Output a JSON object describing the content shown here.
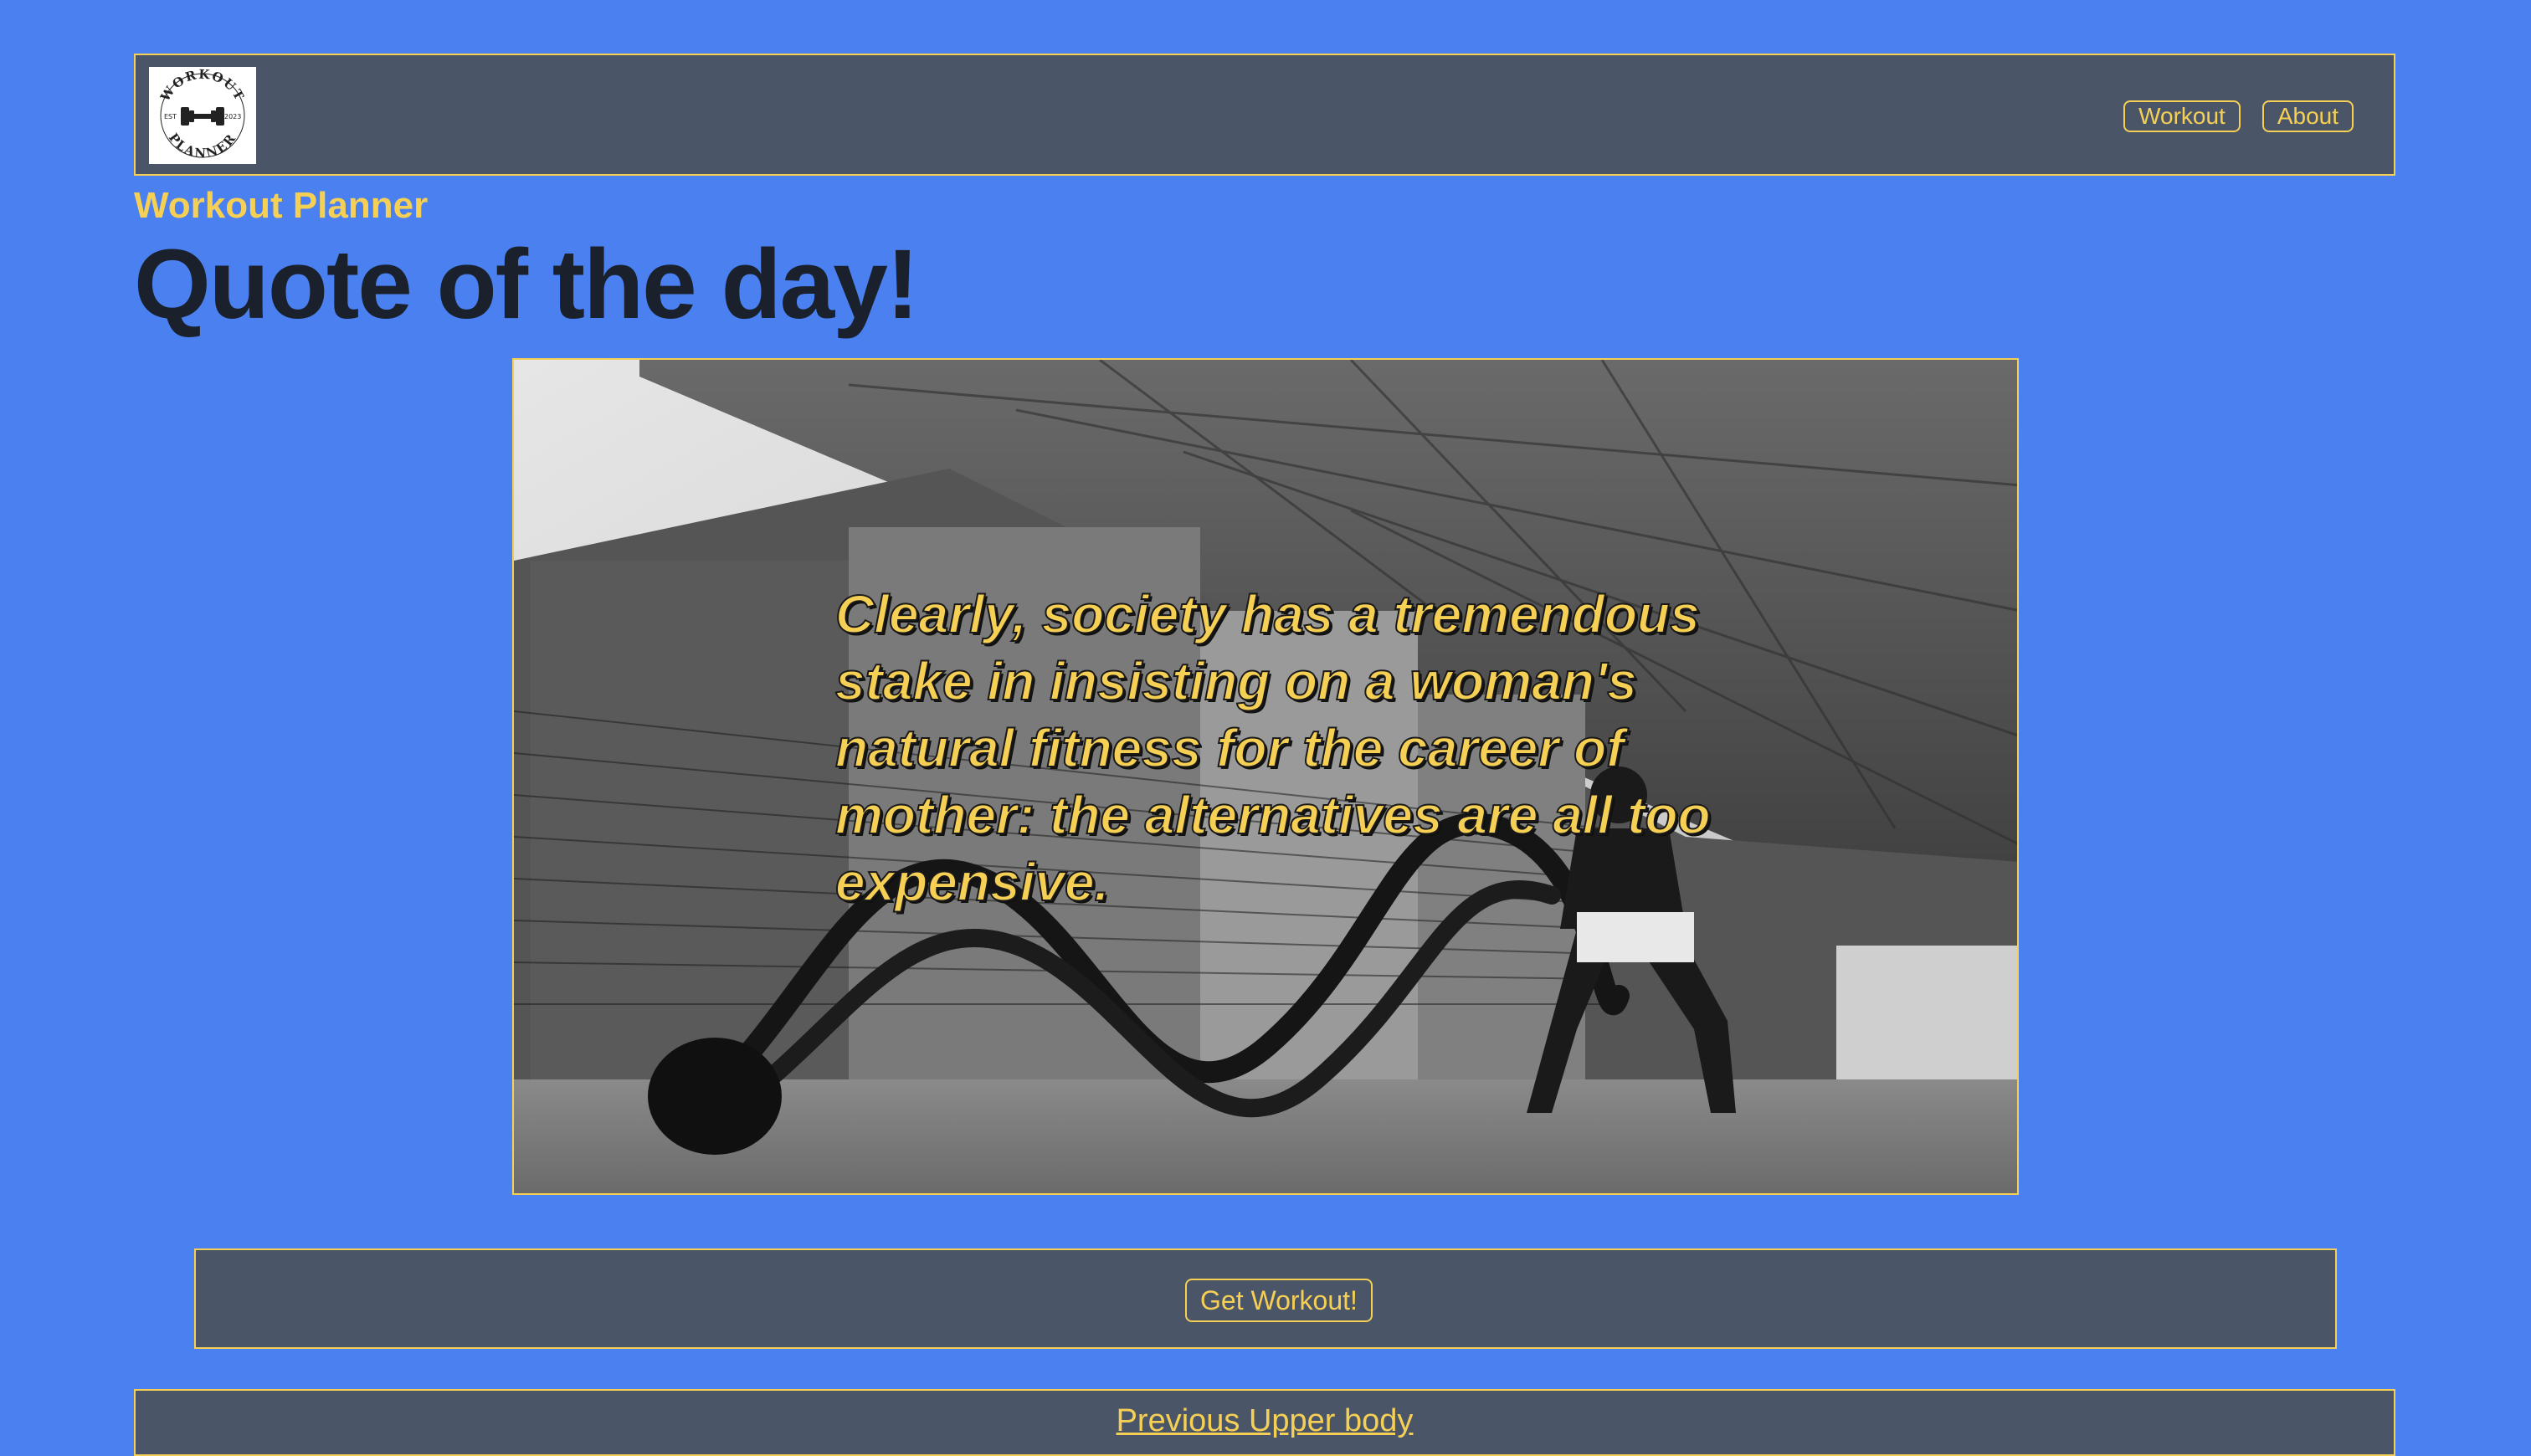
{
  "navbar": {
    "logo": {
      "icon": "workout-planner-logo",
      "text_top": "WORKOUT",
      "text_bottom": "PLANNER",
      "text_left": "EST",
      "text_right": "2023"
    },
    "links": [
      {
        "label": "Workout"
      },
      {
        "label": "About"
      }
    ]
  },
  "brand": "Workout Planner",
  "page_title": "Quote of the day!",
  "hero": {
    "image": "black-and-white photo of athlete training with battle ropes under a concrete overpass",
    "quote": "Clearly, society has a tremendous stake in insisting on a woman's natural fitness for the career of mother: the alternatives are all too expensive."
  },
  "actions": {
    "get_workout_label": "Get Workout!"
  },
  "history": {
    "previous_label": "Previous Upper body"
  },
  "colors": {
    "background": "#4a80ef",
    "panel": "#4a5568",
    "accent": "#f6d055",
    "title": "#1a202c"
  }
}
